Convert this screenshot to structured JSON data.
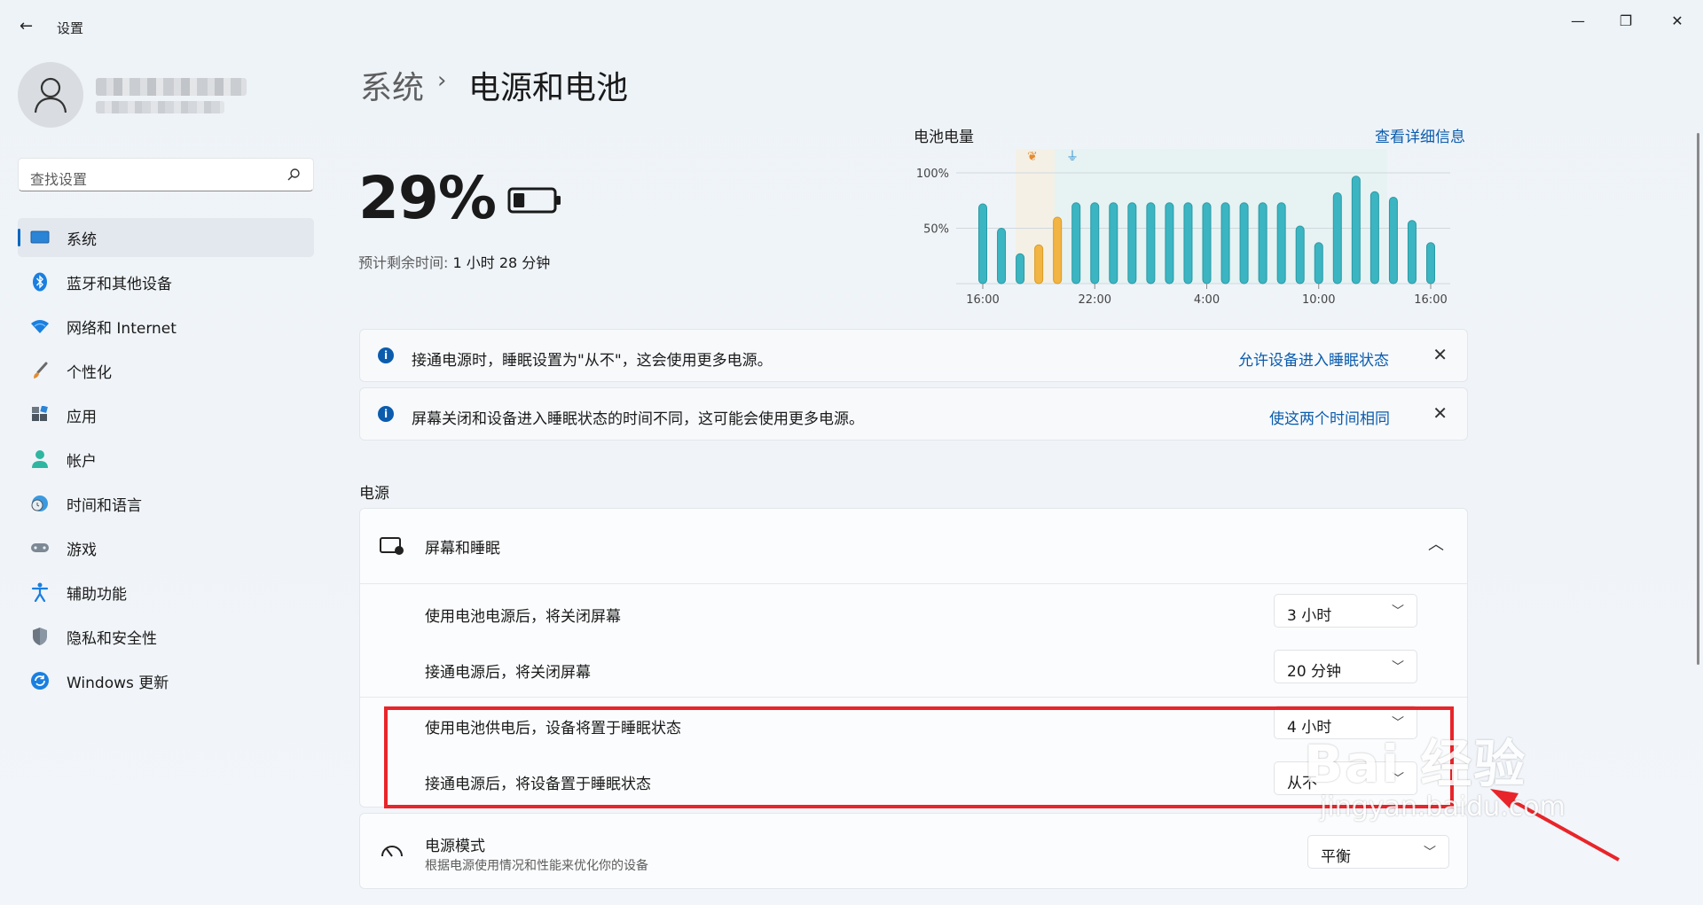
{
  "window": {
    "title": "设置",
    "back": "←",
    "minimize": "—",
    "restore": "❐",
    "close": "✕"
  },
  "search": {
    "placeholder": "查找设置"
  },
  "nav": [
    {
      "label": "系统",
      "icon": "system-icon",
      "selected": true
    },
    {
      "label": "蓝牙和其他设备",
      "icon": "bluetooth-icon"
    },
    {
      "label": "网络和 Internet",
      "icon": "wifi-icon"
    },
    {
      "label": "个性化",
      "icon": "brush-icon"
    },
    {
      "label": "应用",
      "icon": "apps-icon"
    },
    {
      "label": "帐户",
      "icon": "account-icon"
    },
    {
      "label": "时间和语言",
      "icon": "globe-clock-icon"
    },
    {
      "label": "游戏",
      "icon": "gamepad-icon"
    },
    {
      "label": "辅助功能",
      "icon": "accessibility-icon"
    },
    {
      "label": "隐私和安全性",
      "icon": "shield-icon"
    },
    {
      "label": "Windows 更新",
      "icon": "update-icon"
    }
  ],
  "header": {
    "parent": "系统",
    "separator": "›",
    "current": "电源和电池"
  },
  "battery": {
    "percent": "29%",
    "remaining_label": "预计剩余时间: ",
    "remaining_value": "1 小时 28 分钟",
    "level": 0.29
  },
  "chart_data": {
    "type": "bar",
    "title": "电池电量",
    "link": "查看详细信息",
    "y_ticks": [
      "100%",
      "50%"
    ],
    "ylim": [
      0,
      100
    ],
    "x_ticks": [
      "16:00",
      "22:00",
      "4:00",
      "10:00",
      "16:00"
    ],
    "values": [
      72,
      50,
      27,
      35,
      60,
      73,
      73,
      73,
      73,
      73,
      73,
      73,
      73,
      73,
      73,
      73,
      73,
      52,
      37,
      82,
      97,
      83,
      78,
      57,
      37
    ],
    "charging_indices": [
      3,
      4
    ],
    "colors": {
      "bar": "#3bb5c1",
      "charging": "#f2b544"
    }
  },
  "notices": [
    {
      "text": "接通电源时，睡眠设置为\"从不\"，这会使用更多电源。",
      "link": "允许设备进入睡眠状态"
    },
    {
      "text": "屏幕关闭和设备进入睡眠状态的时间不同，这可能会使用更多电源。",
      "link": "使这两个时间相同"
    }
  ],
  "power": {
    "section_title": "电源",
    "screen_sleep": {
      "label": "屏幕和睡眠",
      "rows": [
        {
          "label": "使用电池电源后，将关闭屏幕",
          "value": "3 小时"
        },
        {
          "label": "接通电源后，将关闭屏幕",
          "value": "20 分钟"
        },
        {
          "label": "使用电池供电后，设备将置于睡眠状态",
          "value": "4 小时"
        },
        {
          "label": "接通电源后，将设备置于睡眠状态",
          "value": "从不"
        }
      ]
    },
    "mode": {
      "label": "电源模式",
      "desc": "根据电源使用情况和性能来优化你的设备",
      "value": "平衡"
    }
  },
  "watermark": {
    "main": "Bai 经验",
    "sub": "jingyan.baidu.com"
  }
}
